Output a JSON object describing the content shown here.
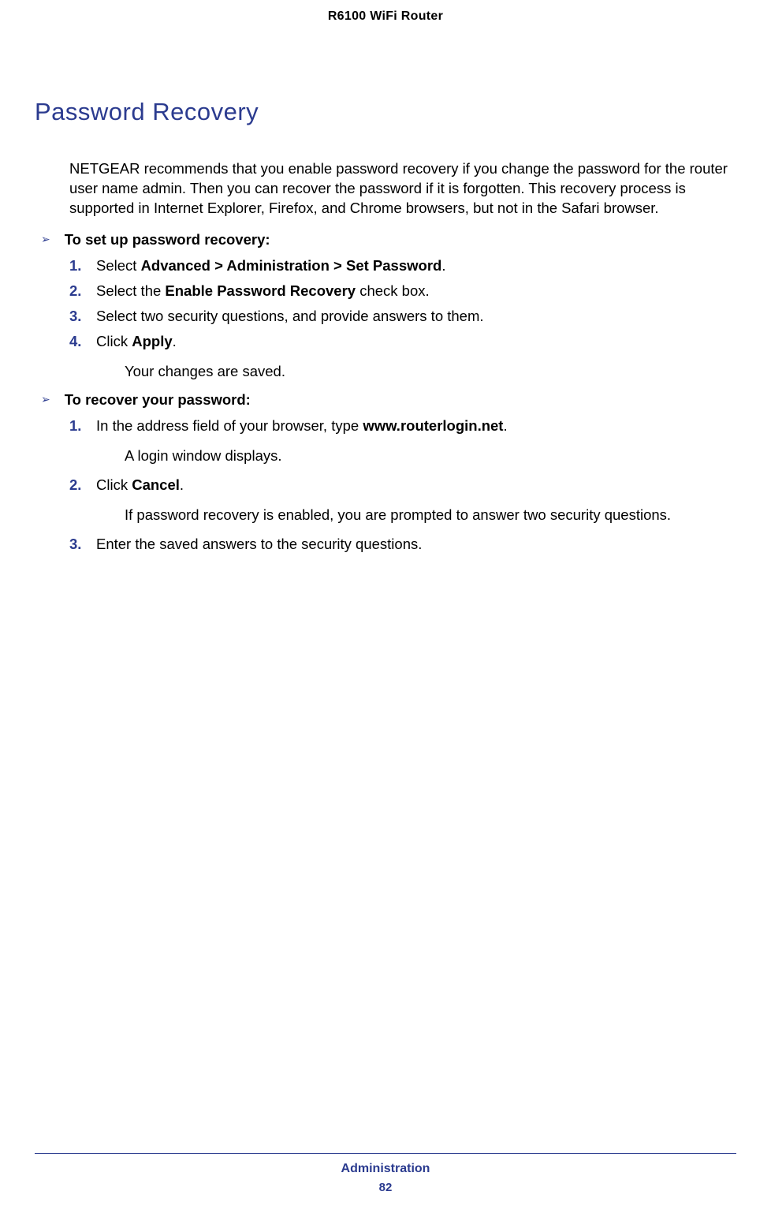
{
  "header": "R6100 WiFi Router",
  "section_title": "Password Recovery",
  "intro": "NETGEAR recommends that you enable password recovery if you change the password for the router user name admin. Then you can recover the password if it is forgotten. This recovery process is supported in Internet Explorer, Firefox, and Chrome browsers, but not in the Safari browser.",
  "proc1": {
    "title": "To set up password recovery:",
    "steps": {
      "s1_num": "1.",
      "s1_pre": "Select ",
      "s1_bold": "Advanced > Administration > Set Password",
      "s1_post": ".",
      "s2_num": "2.",
      "s2_pre": "Select the ",
      "s2_bold": "Enable Password Recovery",
      "s2_post": " check box.",
      "s3_num": "3.",
      "s3_text": "Select two security questions, and provide answers to them.",
      "s4_num": "4.",
      "s4_pre": "Click ",
      "s4_bold": "Apply",
      "s4_post": ".",
      "s4_sub": "Your changes are saved."
    }
  },
  "proc2": {
    "title": "To recover your password:",
    "steps": {
      "s1_num": "1.",
      "s1_pre": "In the address field of your browser, type ",
      "s1_bold": "www.routerlogin.net",
      "s1_post": ".",
      "s1_sub": "A login window displays.",
      "s2_num": "2.",
      "s2_pre": "Click ",
      "s2_bold": "Cancel",
      "s2_post": ".",
      "s2_sub": "If password recovery is enabled, you are prompted to answer two security questions.",
      "s3_num": "3.",
      "s3_text": "Enter the saved answers to the security questions."
    }
  },
  "footer_text": "Administration",
  "page_number": "82",
  "bullet_glyph": "➢"
}
